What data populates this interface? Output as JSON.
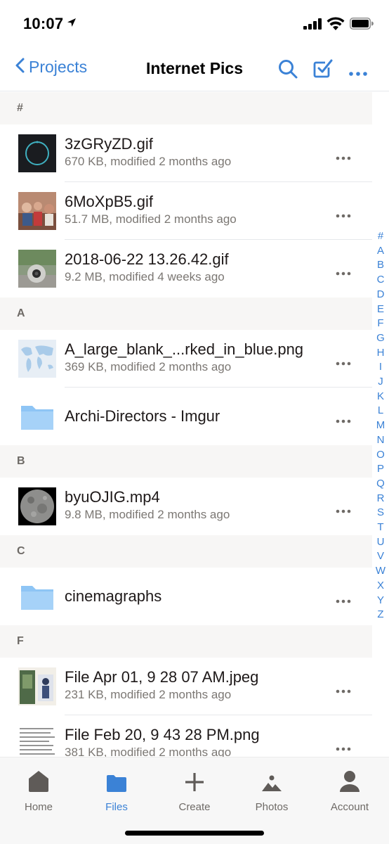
{
  "status_bar": {
    "time": "10:07",
    "icons": [
      "location-arrow-icon",
      "signal-icon",
      "wifi-icon",
      "battery-icon"
    ]
  },
  "nav": {
    "back_label": "Projects",
    "title": "Internet Pics",
    "actions": [
      "search-icon",
      "select-checkbox-icon",
      "more-icon"
    ]
  },
  "colors": {
    "accent": "#3b82d6",
    "folder": "#8ec5f5",
    "section_bg": "#f7f6f5"
  },
  "sections": [
    {
      "letter": "#",
      "items": [
        {
          "name": "3zGRyZD.gif",
          "meta": "670 KB, modified 2 months ago",
          "thumb": "dark-circle-gif-thumbnail"
        },
        {
          "name": "6MoXpB5.gif",
          "meta": "51.7 MB, modified 2 months ago",
          "thumb": "people-gif-thumbnail"
        },
        {
          "name": "2018-06-22 13.26.42.gif",
          "meta": "9.2 MB, modified 4 weeks ago",
          "thumb": "robot-gif-thumbnail"
        }
      ]
    },
    {
      "letter": "A",
      "items": [
        {
          "name": "A_large_blank_...rked_in_blue.png",
          "meta": "369 KB, modified 2 months ago",
          "thumb": "world-map-thumbnail"
        },
        {
          "name": "Archi-Directors - Imgur",
          "meta": "",
          "thumb": "folder-icon"
        }
      ]
    },
    {
      "letter": "B",
      "items": [
        {
          "name": "byuOJIG.mp4",
          "meta": "9.8 MB, modified 2 months ago",
          "thumb": "moon-video-thumbnail"
        }
      ]
    },
    {
      "letter": "C",
      "items": [
        {
          "name": "cinemagraphs",
          "meta": "",
          "thumb": "folder-icon"
        }
      ]
    },
    {
      "letter": "F",
      "items": [
        {
          "name": "File Apr 01, 9 28 07 AM.jpeg",
          "meta": "231 KB, modified 2 months ago",
          "thumb": "poster-jpeg-thumbnail"
        },
        {
          "name": "File Feb 20, 9 43 28 PM.png",
          "meta": "381 KB, modified 2 months ago",
          "thumb": "text-document-thumbnail"
        }
      ]
    }
  ],
  "alpha_index": [
    "#",
    "A",
    "B",
    "C",
    "D",
    "E",
    "F",
    "G",
    "H",
    "I",
    "J",
    "K",
    "L",
    "M",
    "N",
    "O",
    "P",
    "Q",
    "R",
    "S",
    "T",
    "U",
    "V",
    "W",
    "X",
    "Y",
    "Z"
  ],
  "tabs": [
    {
      "label": "Home",
      "icon": "home-icon",
      "active": false
    },
    {
      "label": "Files",
      "icon": "files-folder-icon",
      "active": true
    },
    {
      "label": "Create",
      "icon": "plus-icon",
      "active": false
    },
    {
      "label": "Photos",
      "icon": "photos-icon",
      "active": false
    },
    {
      "label": "Account",
      "icon": "person-icon",
      "active": false
    }
  ]
}
